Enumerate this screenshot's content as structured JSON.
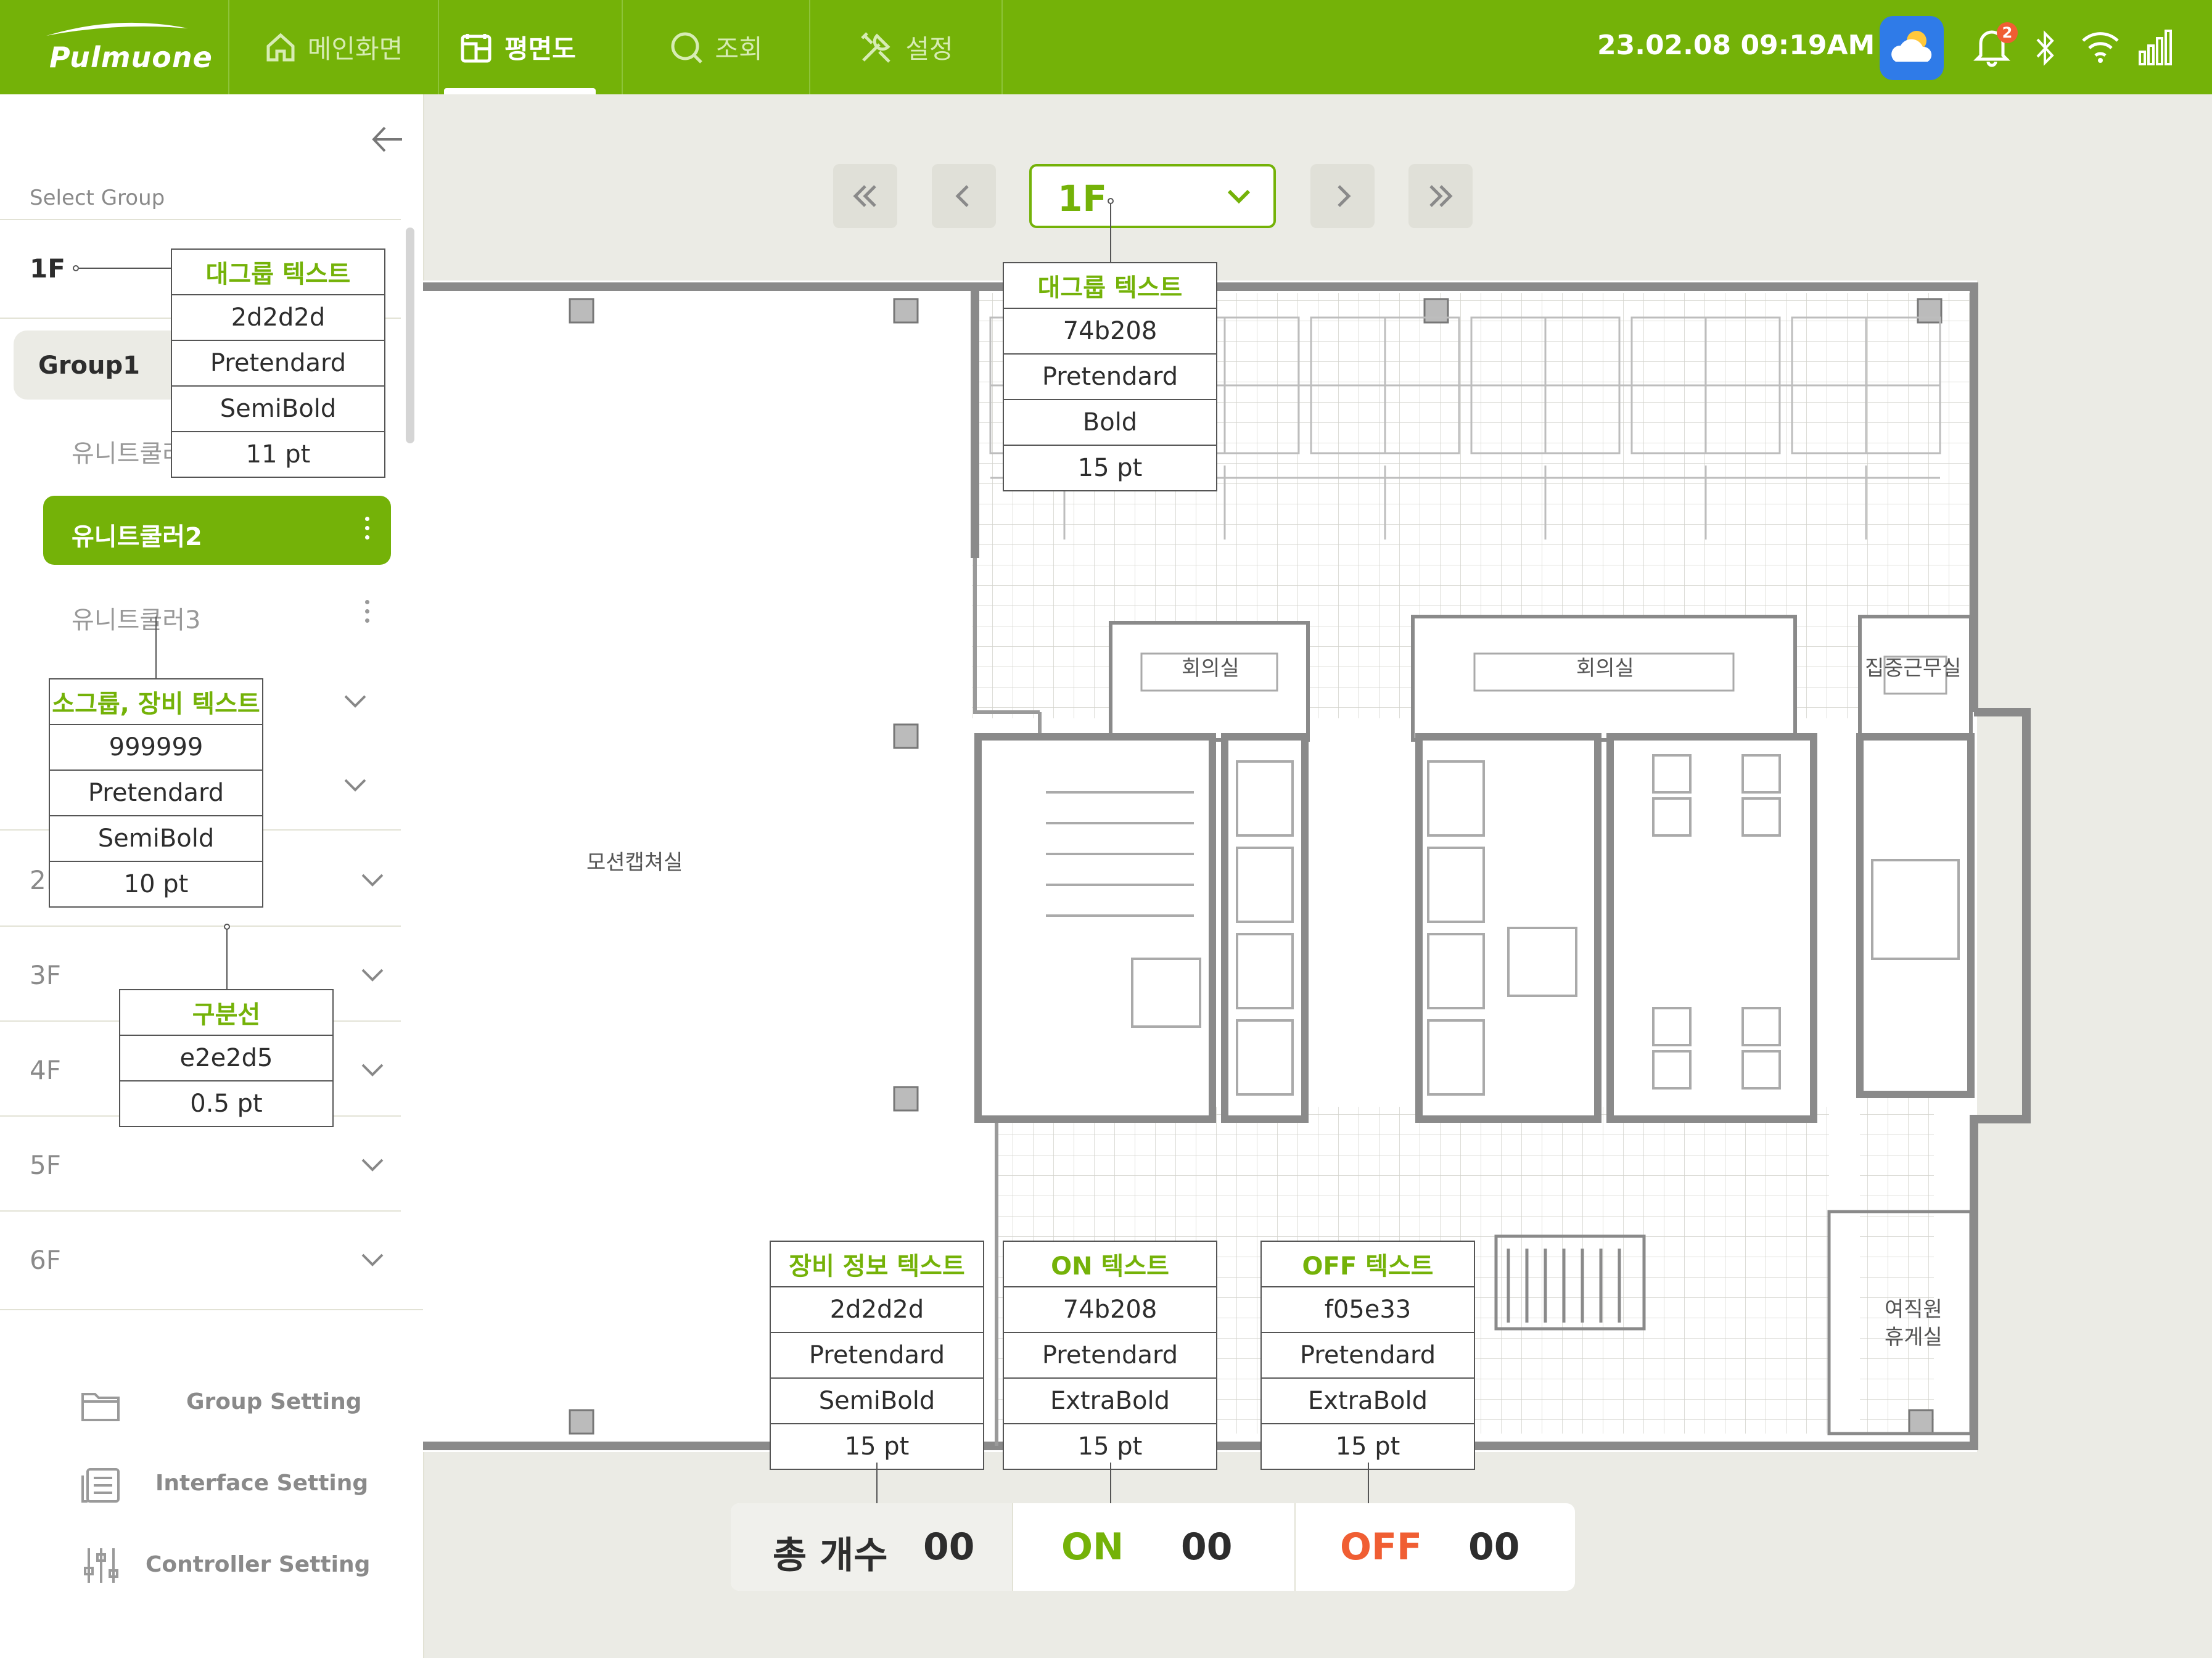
{
  "brand": {
    "name": "Pulmuone",
    "accent": "#74b208",
    "on_color": "#74b208",
    "off_color": "#f05e33"
  },
  "nav": {
    "tabs": [
      {
        "label": "메인화면",
        "icon": "home-icon"
      },
      {
        "label": "평면도",
        "icon": "floorplan-icon"
      },
      {
        "label": "조회",
        "icon": "search-icon"
      },
      {
        "label": "설정",
        "icon": "tools-icon"
      }
    ],
    "active_tab": "평면도"
  },
  "status": {
    "datetime": "23.02.08 09:19AM",
    "notifications": "2",
    "icons": [
      "weather-icon",
      "bell-icon",
      "bluetooth-icon",
      "wifi-icon",
      "signal-icon"
    ]
  },
  "sidebar": {
    "title": "Select Group",
    "floors": [
      {
        "label": "1F"
      },
      {
        "label": "2F"
      },
      {
        "label": "3F"
      },
      {
        "label": "4F"
      },
      {
        "label": "5F"
      },
      {
        "label": "6F"
      }
    ],
    "group": {
      "label": "Group1"
    },
    "units": [
      "유니트쿨러1",
      "유니트쿨러2",
      "유니트쿨러3"
    ],
    "active_unit": "유니트쿨러2",
    "settings": [
      {
        "label": "Group Setting",
        "icon": "folder-icon"
      },
      {
        "label": "Interface Setting",
        "icon": "list-icon"
      },
      {
        "label": "Controller Setting",
        "icon": "sliders-icon"
      }
    ]
  },
  "floor_selector": {
    "value": "1F"
  },
  "plan": {
    "rooms": [
      "모션캡쳐실",
      "회의실",
      "회의실",
      "집중근무실",
      "여직원",
      "휴게실"
    ]
  },
  "specs": {
    "group_text": [
      "대그룹 텍스트",
      "2d2d2d",
      "Pretendard",
      "SemiBold",
      "11 pt"
    ],
    "floor_text": [
      "대그룹 텍스트",
      "74b208",
      "Pretendard",
      "Bold",
      "15 pt"
    ],
    "sub_text": [
      "소그룹, 장비 텍스트",
      "999999",
      "Pretendard",
      "SemiBold",
      "10 pt"
    ],
    "divider": [
      "구분선",
      "e2e2d5",
      "0.5 pt"
    ],
    "device_info": [
      "장비 정보 텍스트",
      "2d2d2d",
      "Pretendard",
      "SemiBold",
      "15 pt"
    ],
    "on_text": [
      "ON 텍스트",
      "74b208",
      "Pretendard",
      "ExtraBold",
      "15 pt"
    ],
    "off_text": [
      "OFF 텍스트",
      "f05e33",
      "Pretendard",
      "ExtraBold",
      "15 pt"
    ]
  },
  "summary": {
    "total_label": "총 개수",
    "total_value": "00",
    "on_label": "ON",
    "on_value": "00",
    "off_label": "OFF",
    "off_value": "00"
  }
}
